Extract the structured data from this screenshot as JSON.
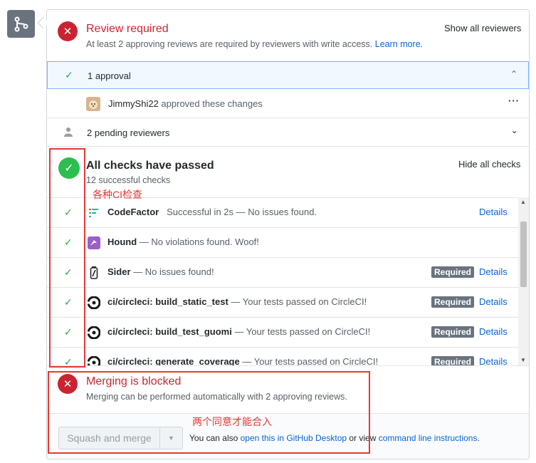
{
  "review": {
    "title": "Review required",
    "subtitle": "At least 2 approving reviews are required by reviewers with write access.",
    "learn_more": "Learn more.",
    "show_all": "Show all reviewers"
  },
  "approval": {
    "label": "1 approval",
    "reviewer_name": "JimmyShi22",
    "reviewer_action": "approved these changes"
  },
  "pending": {
    "label": "2 pending reviewers"
  },
  "checks": {
    "title": "All checks have passed",
    "subtitle": "12 successful checks",
    "hide_all": "Hide all checks",
    "items": [
      {
        "name": "CodeFactor",
        "desc": "Successful in 2s — No issues found.",
        "required": "",
        "details": "Details"
      },
      {
        "name": "Hound",
        "desc": "— No violations found. Woof!",
        "required": "",
        "details": ""
      },
      {
        "name": "Sider",
        "desc": "— No issues found!",
        "required": "Required",
        "details": "Details"
      },
      {
        "name": "ci/circleci: build_static_test",
        "desc": "— Your tests passed on CircleCI!",
        "required": "Required",
        "details": "Details"
      },
      {
        "name": "ci/circleci: build_test_guomi",
        "desc": "— Your tests passed on CircleCI!",
        "required": "Required",
        "details": "Details"
      },
      {
        "name": "ci/circleci: generate_coverage",
        "desc": "— Your tests passed on CircleCI!",
        "required": "Required",
        "details": "Details"
      }
    ]
  },
  "merge": {
    "title": "Merging is blocked",
    "subtitle": "Merging can be performed automatically with 2 approving reviews.",
    "button": "Squash and merge",
    "also_prefix": "You can also",
    "open_desktop": "open this in GitHub Desktop",
    "or_view": "or view",
    "cli": "command line instructions",
    "period": "."
  },
  "annotations": {
    "ci_label": "各种CI检查",
    "merge_label": "两个同意才能合入"
  },
  "colors": {
    "success": "#28a745",
    "danger": "#cb2431",
    "link": "#0366d6",
    "annotation": "#e53935"
  }
}
